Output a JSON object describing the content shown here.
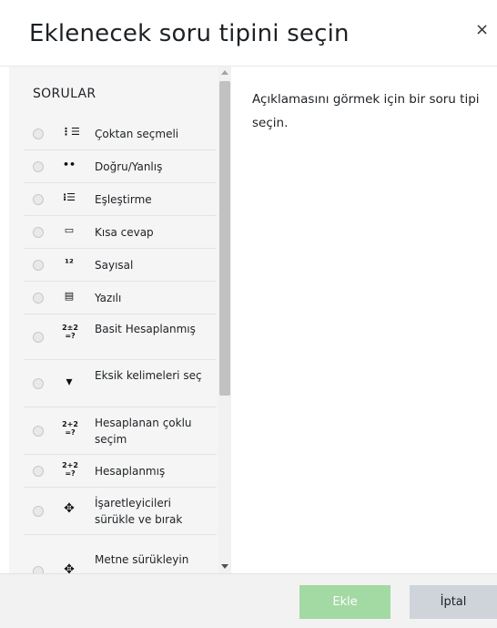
{
  "dialog": {
    "title": "Eklenecek soru tipini seçin",
    "close_symbol": "×"
  },
  "list": {
    "section_title": "SORULAR",
    "items": [
      {
        "label": "Çoktan seçmeli",
        "icon": "multichoice-icon",
        "glyph": "⋮☰"
      },
      {
        "label": "Doğru/Yanlış",
        "icon": "truefalse-icon",
        "glyph": "••"
      },
      {
        "label": "Eşleştirme",
        "icon": "matching-icon",
        "glyph": "⁝☰"
      },
      {
        "label": "Kısa cevap",
        "icon": "shortanswer-icon",
        "glyph": "▭"
      },
      {
        "label": "Sayısal",
        "icon": "numerical-icon",
        "glyph": "¹²"
      },
      {
        "label": "Yazılı",
        "icon": "essay-icon",
        "glyph": "▤"
      },
      {
        "label": "Basit Hesaplanmış",
        "icon": "calculatedsimple-icon",
        "glyph": "2±2 =?"
      },
      {
        "label": "Eksik kelimeleri seç",
        "icon": "gapselect-icon",
        "glyph": "▾"
      },
      {
        "label": "Hesaplanan çoklu seçim",
        "icon": "calculatedmulti-icon",
        "glyph": "2+2 =?"
      },
      {
        "label": "Hesaplanmış",
        "icon": "calculated-icon",
        "glyph": "2+2 =?"
      },
      {
        "label": "İşaretleyicileri sürükle ve bırak",
        "icon": "ddmarker-icon",
        "glyph": "✥"
      },
      {
        "label": "Metne sürükleyin",
        "icon": "ddwtos-icon",
        "glyph": "✥"
      }
    ]
  },
  "description": "Açıklamasını görmek için bir soru tipi seçin.",
  "footer": {
    "add_label": "Ekle",
    "cancel_label": "İptal"
  },
  "colors": {
    "add_button": "#a3d9a3",
    "cancel_button": "#ced4da",
    "list_background": "#f5f5f5"
  }
}
